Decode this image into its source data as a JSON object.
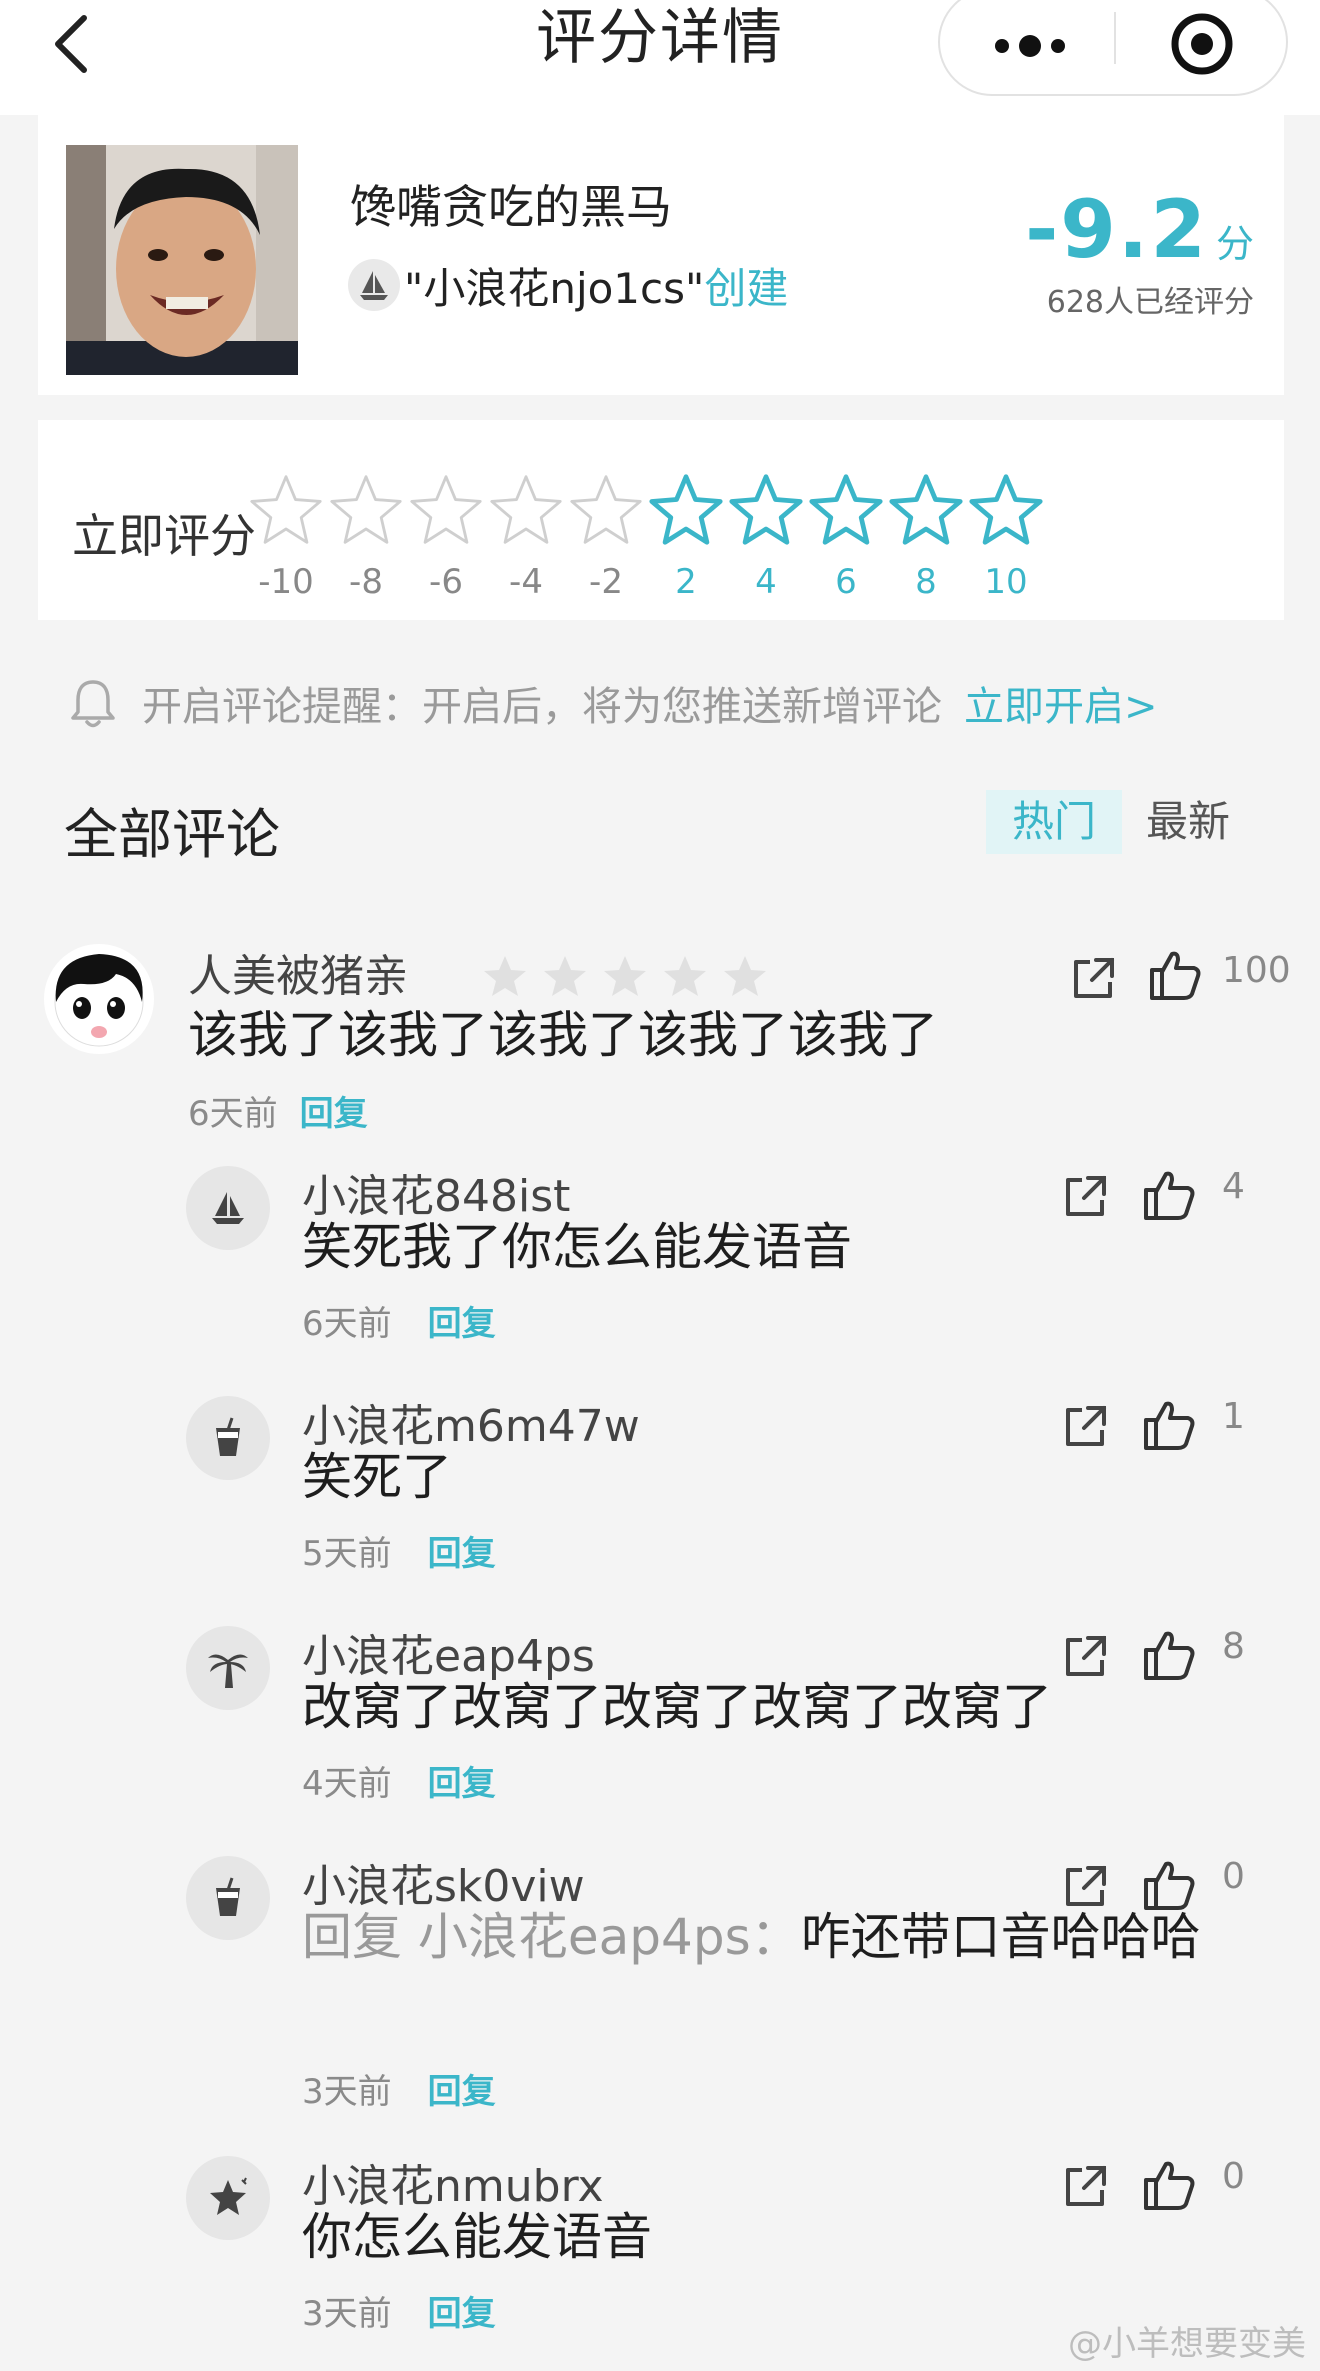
{
  "header": {
    "title": "评分详情",
    "back_icon": "chevron-left-icon",
    "more_icon": "more-dots-icon",
    "target_icon": "target-icon"
  },
  "target": {
    "name": "馋嘴贪吃的黑马",
    "creator_prefix": "\"小浪花njo1cs\"",
    "creator_suffix": "创建",
    "score": "-9.2",
    "score_unit": "分",
    "rater_count": "628人已经评分"
  },
  "rating": {
    "label": "立即评分",
    "options": [
      {
        "score": "-10",
        "active": false
      },
      {
        "score": "-8",
        "active": false
      },
      {
        "score": "-6",
        "active": false
      },
      {
        "score": "-4",
        "active": false
      },
      {
        "score": "-2",
        "active": false
      },
      {
        "score": "2",
        "active": true
      },
      {
        "score": "4",
        "active": true
      },
      {
        "score": "6",
        "active": true
      },
      {
        "score": "8",
        "active": true
      },
      {
        "score": "10",
        "active": true
      }
    ]
  },
  "reminder": {
    "text": "开启评论提醒：开启后，将为您推送新增评论",
    "link": "立即开启>"
  },
  "comments_section": {
    "title": "全部评论",
    "sort_hot": "热门",
    "sort_new": "最新"
  },
  "comments": [
    {
      "name": "人美被猪亲",
      "text": "该我了该我了该我了该我了该我了",
      "time": "6天前",
      "reply": "回复",
      "likes": "100",
      "rating_stars": 0
    }
  ],
  "replies": [
    {
      "name": "小浪花848ist",
      "text": "笑死我了你怎么能发语音",
      "time": "6天前",
      "reply": "回复",
      "likes": "4",
      "avatar_icon": "sailboat-icon"
    },
    {
      "name": "小浪花m6m47w",
      "text": "笑死了",
      "time": "5天前",
      "reply": "回复",
      "likes": "1",
      "avatar_icon": "drink-cup-icon"
    },
    {
      "name": "小浪花eap4ps",
      "text": "改窝了改窝了改窝了改窝了改窝了",
      "time": "4天前",
      "reply": "回复",
      "likes": "8",
      "avatar_icon": "palm-tree-icon"
    },
    {
      "name": "小浪花sk0viw",
      "reply_to": "回复 小浪花eap4ps：",
      "text": "咋还带口音哈哈哈",
      "time": "3天前",
      "reply": "回复",
      "likes": "0",
      "avatar_icon": "drink-cup-icon"
    },
    {
      "name": "小浪花nmubrx",
      "text": "你怎么能发语音",
      "time": "3天前",
      "reply": "回复",
      "likes": "0",
      "avatar_icon": "star-icon"
    }
  ],
  "watermark": "@小羊想要变美",
  "colors": {
    "accent": "#3bb6c9",
    "background": "#f4f4f4"
  }
}
